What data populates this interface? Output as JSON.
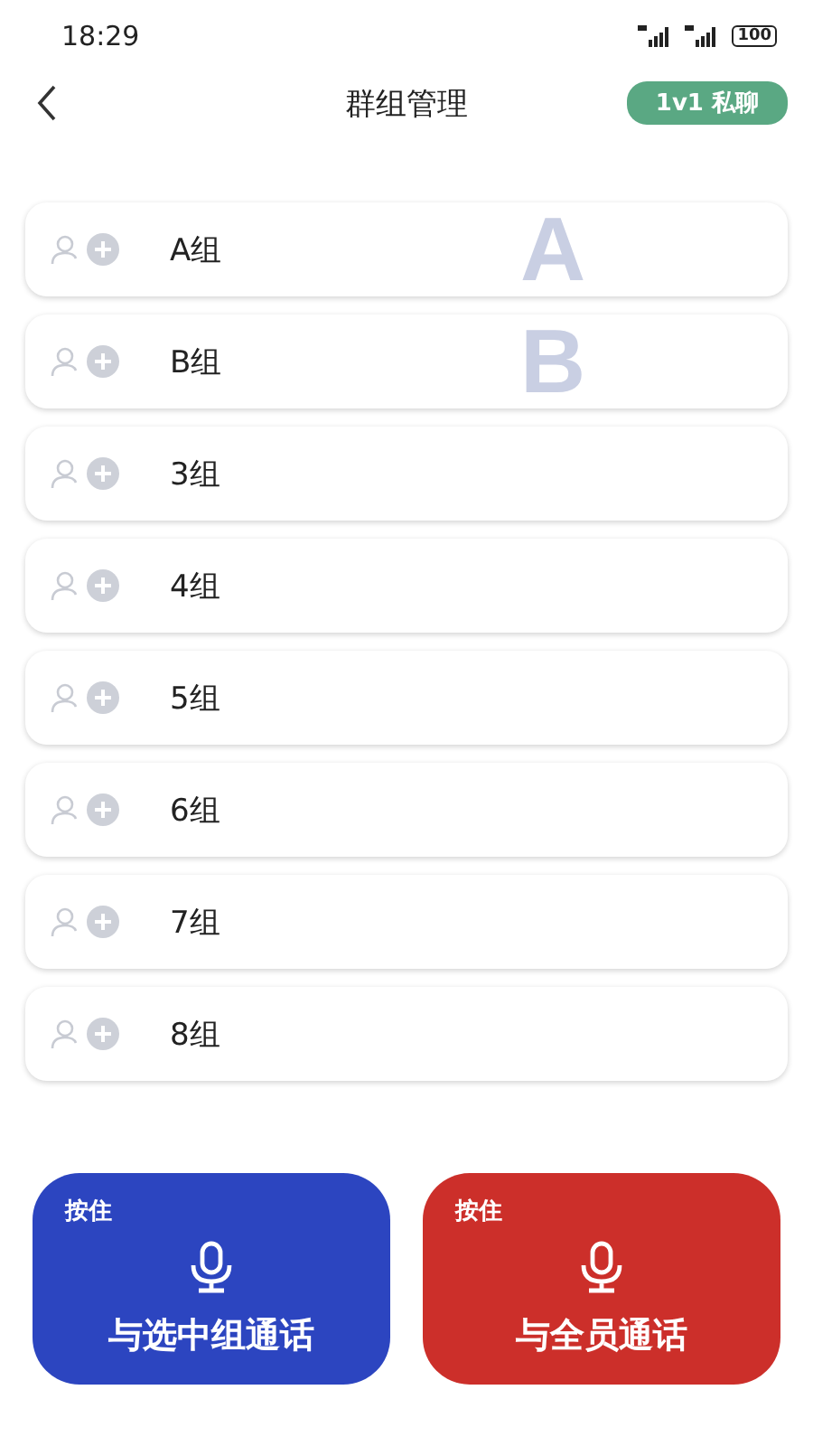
{
  "status_bar": {
    "time": "18:29",
    "battery": "100"
  },
  "header": {
    "title": "群组管理",
    "badge": "1v1 私聊"
  },
  "groups": [
    {
      "name": "A组",
      "backdrop_letter": "A"
    },
    {
      "name": "B组",
      "backdrop_letter": "B"
    },
    {
      "name": "3组"
    },
    {
      "name": "4组"
    },
    {
      "name": "5组"
    },
    {
      "name": "6组"
    },
    {
      "name": "7组"
    },
    {
      "name": "8组"
    }
  ],
  "talk_buttons": [
    {
      "hint": "按住",
      "label": "与选中组通话",
      "color": "#2c45c0"
    },
    {
      "hint": "按住",
      "label": "与全员通话",
      "color": "#cc2f2a"
    }
  ]
}
